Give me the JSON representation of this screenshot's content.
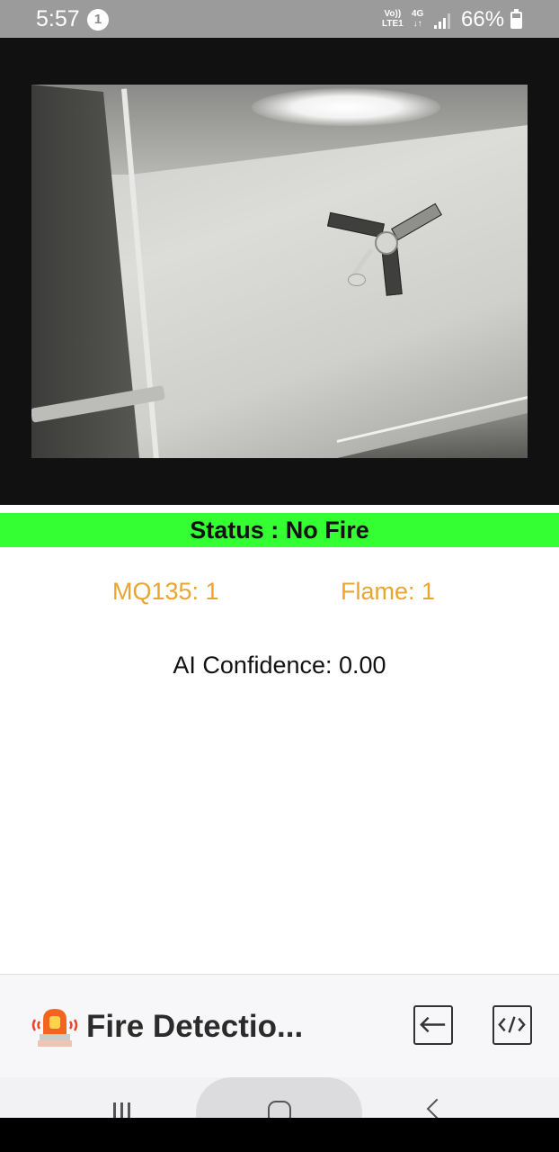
{
  "status_bar": {
    "time": "5:57",
    "notification_count": "1",
    "volte_line1": "Vo))",
    "volte_line2": "LTE1",
    "network_line1": "4G",
    "network_line2": "↓↑",
    "battery_text": "66%",
    "battery_level_percent": 66
  },
  "camera": {
    "icon": "camera-feed"
  },
  "status_banner": {
    "text": "Status : No Fire",
    "color": "#33ff33"
  },
  "sensors": {
    "mq135": "MQ135: 1",
    "flame": "Flame: 1",
    "color": "#e8a531"
  },
  "ai": {
    "confidence": "AI Confidence: 0.00"
  },
  "app_bar": {
    "title": "Fire Detectio...",
    "app_icon": "siren-icon",
    "exit_icon": "exit-icon",
    "code_icon": "code-icon"
  },
  "nav_bar": {
    "recents_icon": "recents-icon",
    "home_icon": "home-icon",
    "back_icon": "back-icon"
  }
}
